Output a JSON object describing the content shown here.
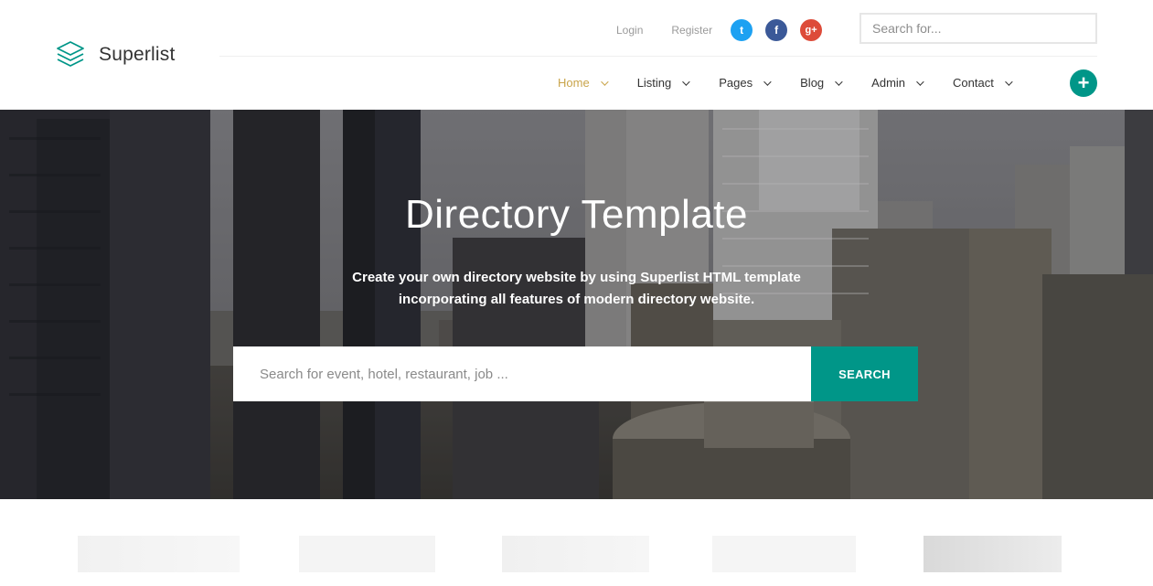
{
  "header": {
    "brand": "Superlist",
    "top_links": [
      {
        "label": "Login"
      },
      {
        "label": "Register"
      }
    ],
    "social": [
      {
        "icon": "twitter-icon",
        "glyph": "t",
        "color": "#1da1f2"
      },
      {
        "icon": "facebook-icon",
        "glyph": "f",
        "color": "#3b5998"
      },
      {
        "icon": "google-plus-icon",
        "glyph": "g+",
        "color": "#dd4b39"
      }
    ],
    "search": {
      "placeholder": "Search for...",
      "value": ""
    },
    "nav": [
      {
        "label": "Home",
        "active": true
      },
      {
        "label": "Listing"
      },
      {
        "label": "Pages"
      },
      {
        "label": "Blog"
      },
      {
        "label": "Admin"
      },
      {
        "label": "Contact"
      }
    ],
    "add_button": {
      "icon": "plus-icon",
      "glyph": "+"
    }
  },
  "hero": {
    "title": "Directory Template",
    "subtitle_line1": "Create your own directory website by using Superlist HTML template",
    "subtitle_line2": "incorporating all features of modern directory website.",
    "search": {
      "placeholder": "Search for event, hotel, restaurant, job ...",
      "value": ""
    },
    "search_button": "SEARCH"
  },
  "colors": {
    "accent": "#009688",
    "nav_active": "#c9a44a"
  }
}
